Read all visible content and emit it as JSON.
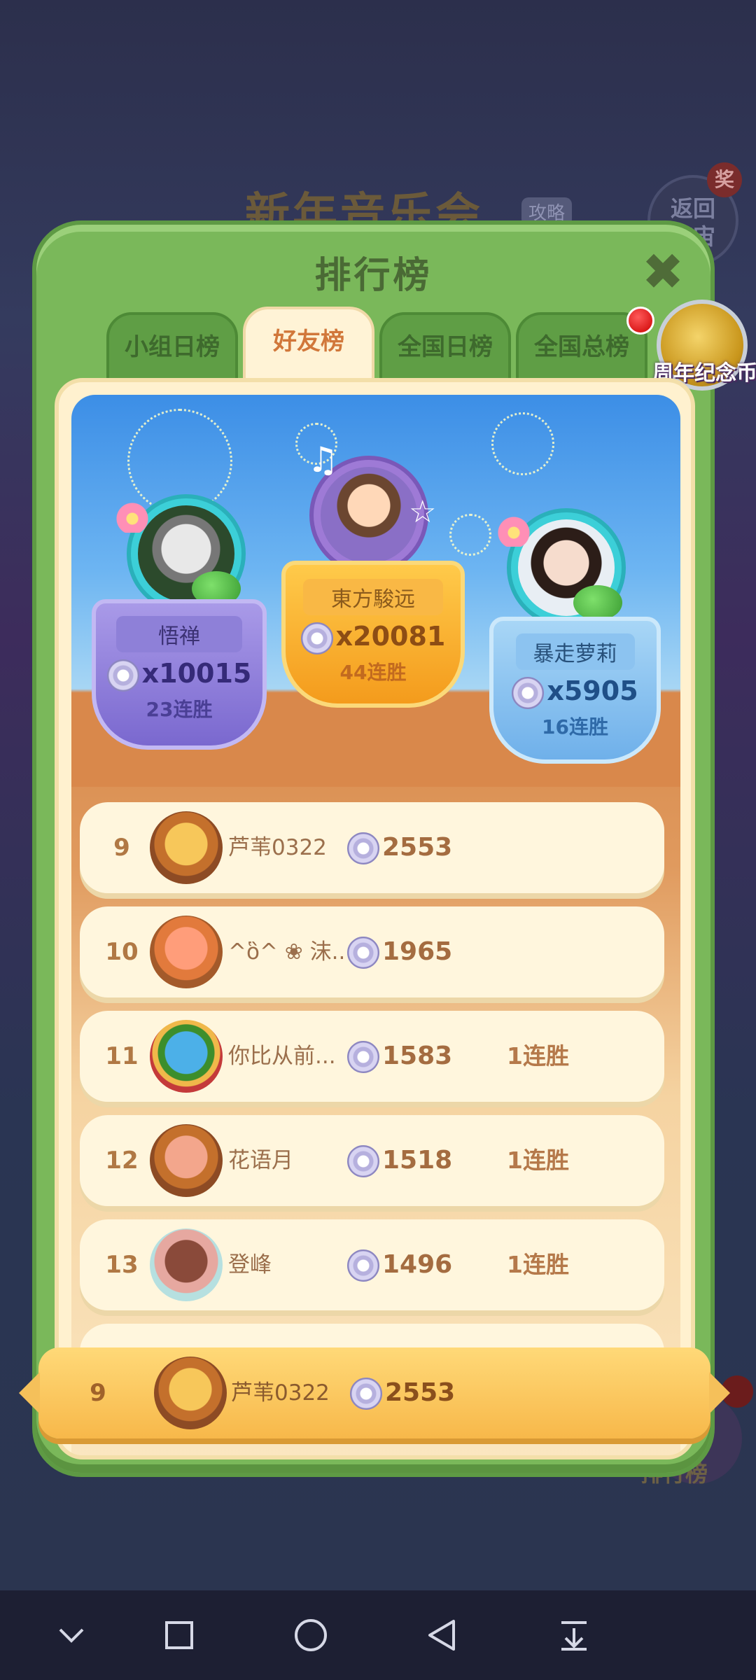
{
  "background": {
    "title": "新年音乐会",
    "tag": "攻略",
    "return_label": "返回\n宇宙",
    "return_badge": "奖",
    "bottom_label": "排行榜"
  },
  "modal": {
    "title": "排行榜",
    "tabs": [
      {
        "label": "小组日榜",
        "active": false
      },
      {
        "label": "好友榜",
        "active": true
      },
      {
        "label": "全国日榜",
        "active": false
      },
      {
        "label": "全国总榜",
        "active": false
      }
    ],
    "coin_label": "周年纪念币"
  },
  "podium": {
    "first": {
      "name": "東方駿远",
      "score": "x20081",
      "streak": "44连胜"
    },
    "second": {
      "name": "悟禅",
      "score": "x10015",
      "streak": "23连胜"
    },
    "third": {
      "name": "暴走萝莉",
      "score": "x5905",
      "streak": "16连胜"
    }
  },
  "list": [
    {
      "rank": "9",
      "name": "芦苇0322",
      "score": "2553",
      "streak": ""
    },
    {
      "rank": "10",
      "name": "^ὃ^ ❀ 沫...",
      "score": "1965",
      "streak": ""
    },
    {
      "rank": "11",
      "name": "你比从前...",
      "score": "1583",
      "streak": "1连胜"
    },
    {
      "rank": "12",
      "name": "花语月",
      "score": "1518",
      "streak": "1连胜"
    },
    {
      "rank": "13",
      "name": "登峰",
      "score": "1496",
      "streak": "1连胜"
    }
  ],
  "me": {
    "rank": "9",
    "name": "芦苇0322",
    "score": "2553"
  },
  "colors": {
    "accent": "#d1773a",
    "modal_green": "#7ab85a",
    "gold": "#f7b84a"
  }
}
